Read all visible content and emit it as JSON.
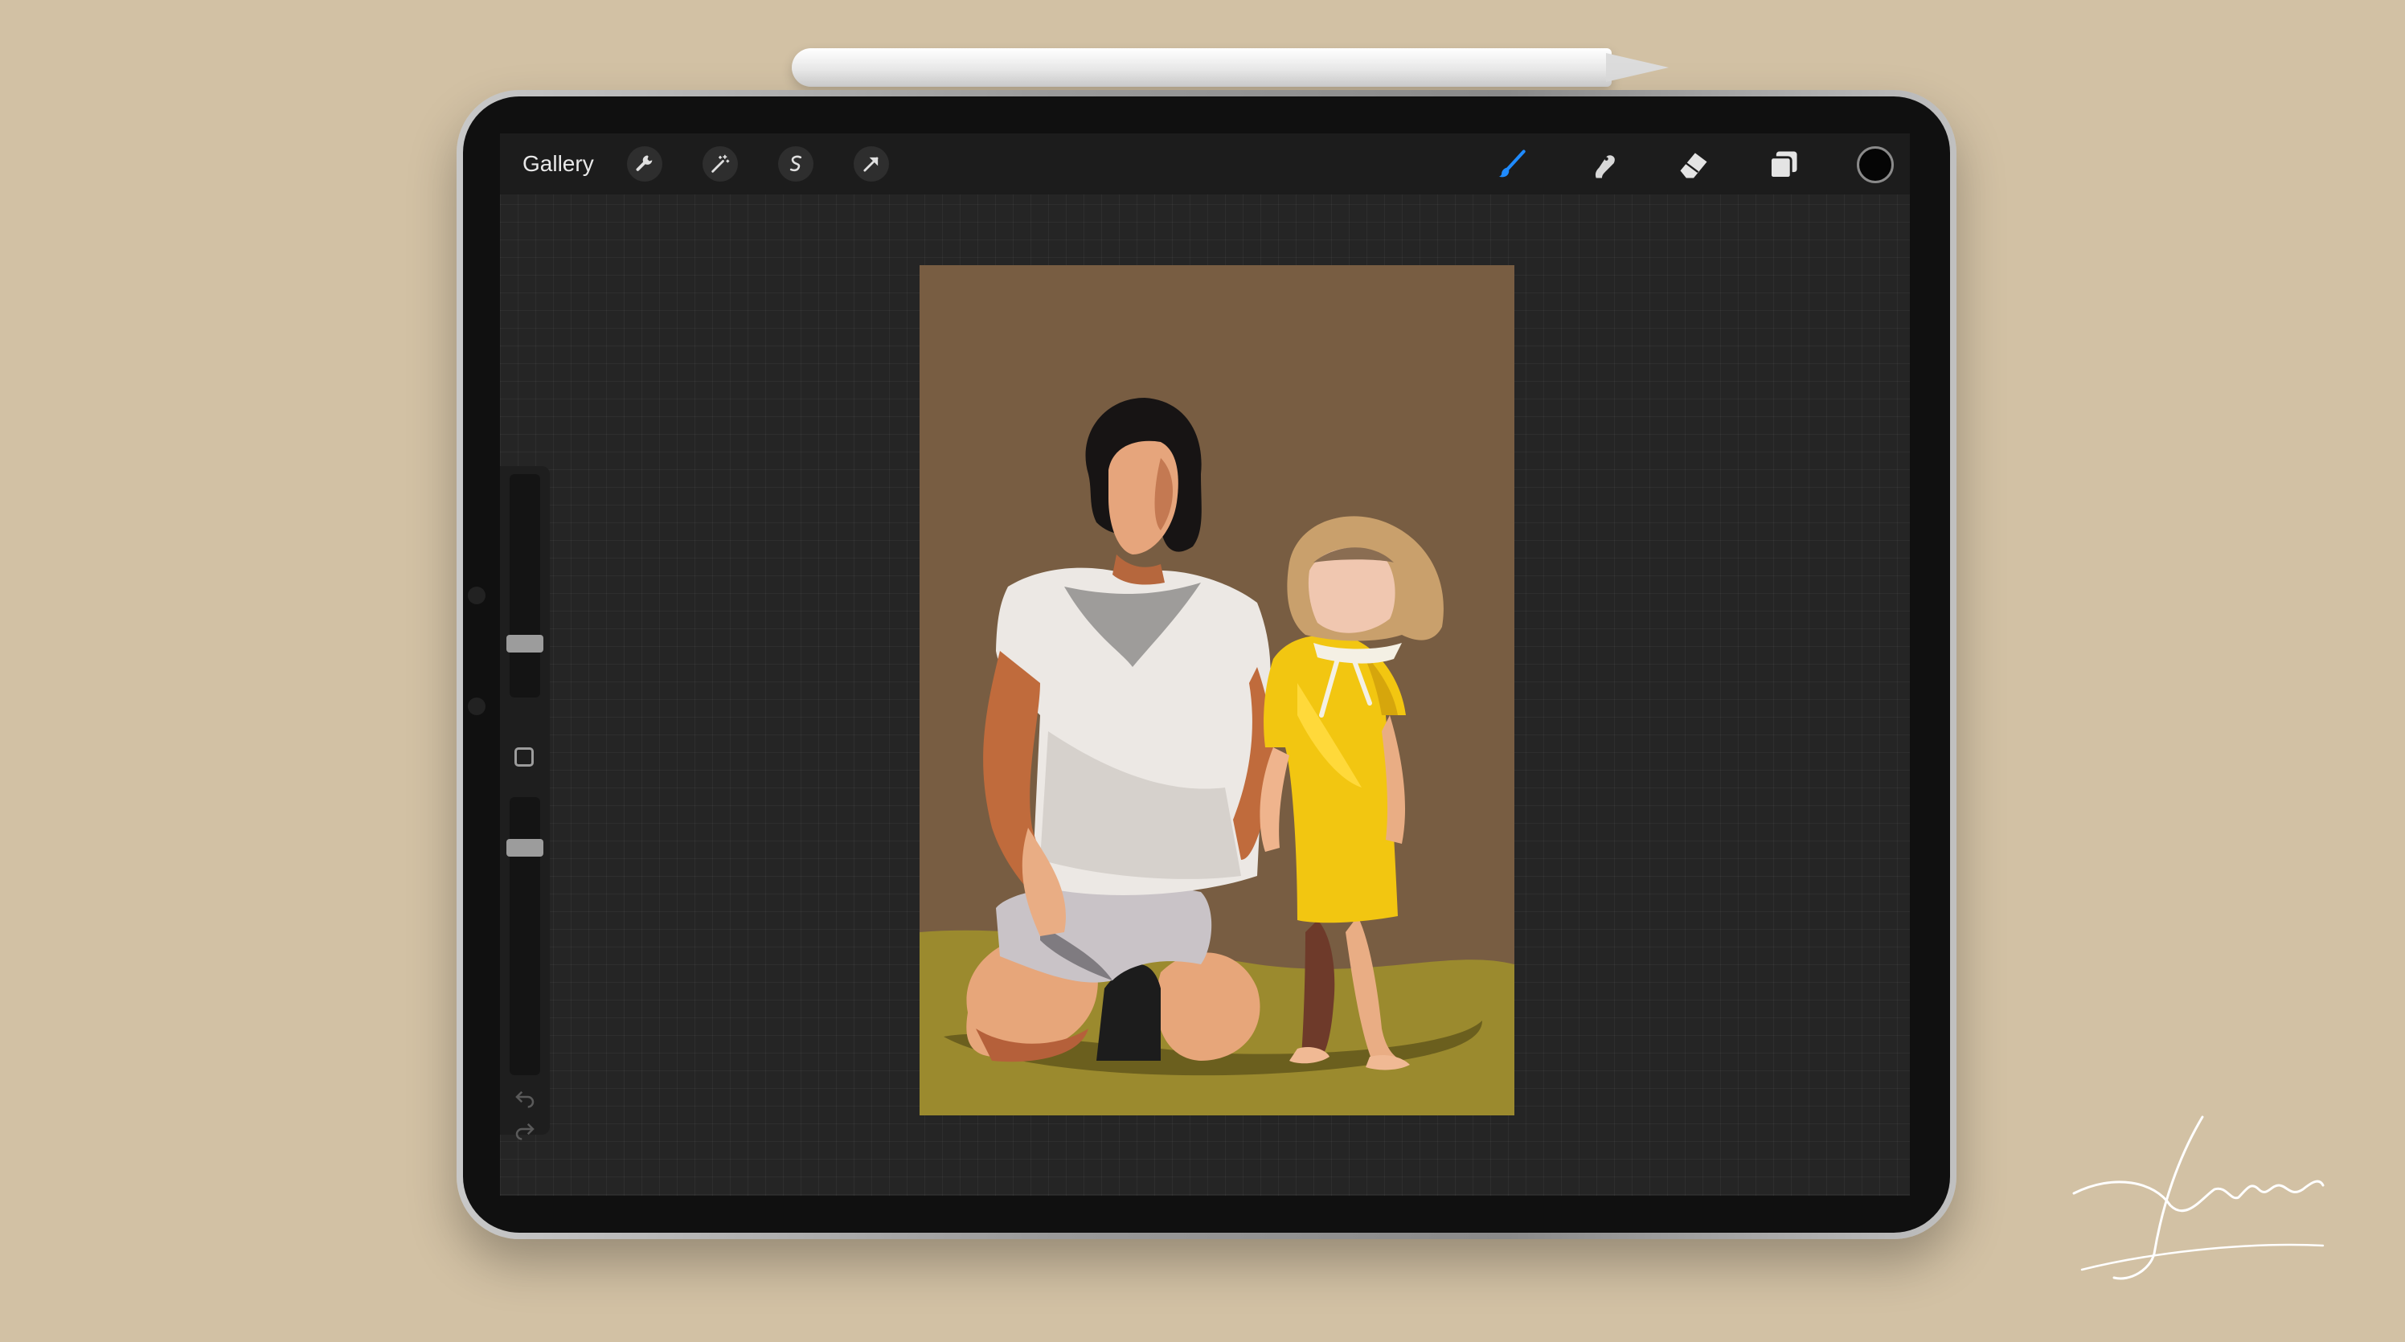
{
  "toolbar": {
    "gallery_label": "Gallery",
    "left_tools": [
      "wrench-icon",
      "magic-wand-icon",
      "selection-icon",
      "transform-arrow-icon"
    ],
    "right_tools": [
      "brush-icon",
      "smudge-icon",
      "eraser-icon",
      "layers-icon"
    ],
    "active_tool": "brush-icon",
    "active_color": "#050505",
    "accent_color": "#1f8bff"
  },
  "sidebar": {
    "brush_size_level": 0.22,
    "opacity_level": 0.84,
    "icons": [
      "modify-square-icon",
      "undo-icon",
      "redo-icon"
    ]
  },
  "canvas": {
    "background_color": "#785d42",
    "ground_color": "#9b8a2e"
  }
}
